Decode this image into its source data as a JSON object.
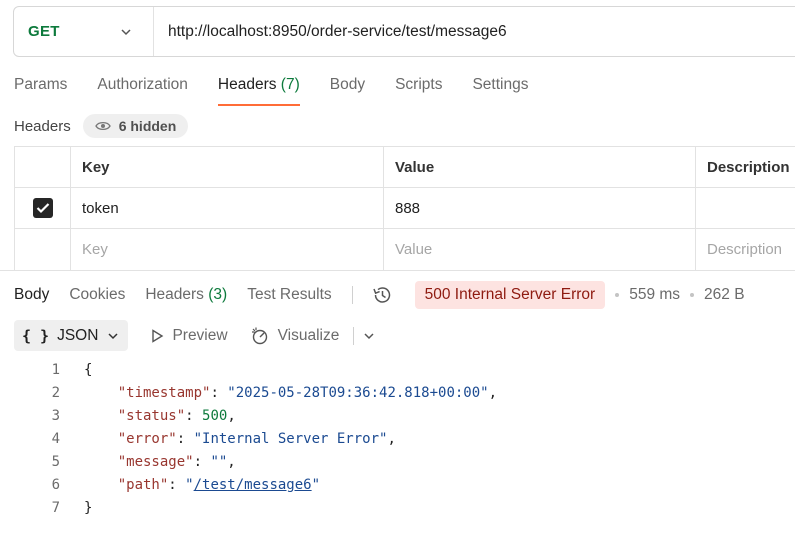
{
  "request": {
    "method": "GET",
    "url": "http://localhost:8950/order-service/test/message6"
  },
  "request_tabs": [
    {
      "label": "Params"
    },
    {
      "label": "Authorization"
    },
    {
      "label": "Headers",
      "count": "(7)",
      "active": true
    },
    {
      "label": "Body"
    },
    {
      "label": "Scripts"
    },
    {
      "label": "Settings"
    }
  ],
  "headers_section": {
    "title": "Headers",
    "hidden_label": "6 hidden",
    "columns": {
      "key": "Key",
      "value": "Value",
      "description": "Description"
    },
    "rows": [
      {
        "checked": true,
        "key": "token",
        "value": "888",
        "description": ""
      }
    ],
    "placeholders": {
      "key": "Key",
      "value": "Value",
      "description": "Description"
    }
  },
  "response": {
    "tabs": {
      "body": "Body",
      "cookies": "Cookies",
      "headers": "Headers",
      "headers_count": "(3)",
      "test_results": "Test Results"
    },
    "status": "500 Internal Server Error",
    "time": "559 ms",
    "size": "262 B",
    "format": "JSON",
    "preview": "Preview",
    "visualize": "Visualize",
    "body_lines": [
      {
        "num": "1",
        "open": "{"
      },
      {
        "num": "2",
        "key": "\"timestamp\"",
        "value": "\"2025-05-28T09:36:42.818+00:00\"",
        "type": "string",
        "comma": ","
      },
      {
        "num": "3",
        "key": "\"status\"",
        "value": "500",
        "type": "number",
        "comma": ","
      },
      {
        "num": "4",
        "key": "\"error\"",
        "value": "\"Internal Server Error\"",
        "type": "string",
        "comma": ","
      },
      {
        "num": "5",
        "key": "\"message\"",
        "value": "\"\"",
        "type": "string",
        "comma": ","
      },
      {
        "num": "6",
        "key": "\"path\"",
        "value_open": "\"",
        "value_link": "/test/message6",
        "value_close": "\"",
        "type": "link"
      },
      {
        "num": "7",
        "open": "}"
      }
    ]
  },
  "colors": {
    "method": "#0d7a3c",
    "accent": "#ff6c37",
    "error_bg": "#fde3e1",
    "error_text": "#8e1a10",
    "json_key": "#98362f",
    "json_string": "#1b4a91",
    "json_number": "#0d7a3c"
  }
}
